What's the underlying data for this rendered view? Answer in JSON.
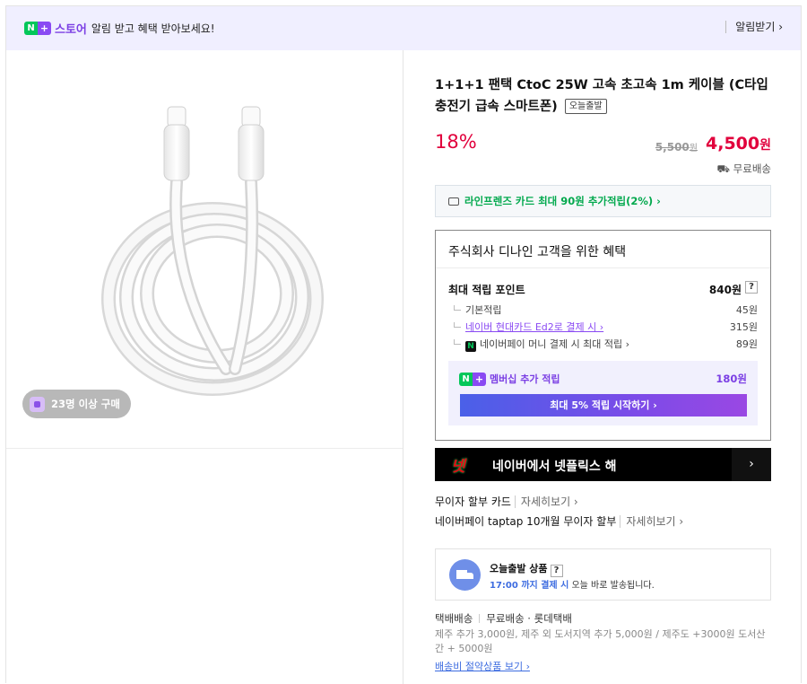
{
  "banner": {
    "badge_n": "N",
    "badge_plus": "+",
    "store": "스토어",
    "text": "알림 받고 혜택 받아보세요!",
    "action": "알림받기 ›"
  },
  "gallery": {
    "buyers_pill": "23명 이상 구매"
  },
  "product": {
    "title": "1+1+1 팬택 CtoC 25W 고속 초고속 1m 케이블 (C타입 충전기 급속 스마트폰)",
    "tag": "오늘출발",
    "discount": "18%",
    "original_price": "5,500",
    "original_unit": "원",
    "price": "4,500",
    "price_unit": "원",
    "shipping": "무료배송"
  },
  "card_benefit": "라인프렌즈 카드 최대 90원 추가적립(2%) ›",
  "benefits": {
    "title": "주식회사 디나인 고객을 위한 혜택",
    "max_label": "최대 적립 포인트",
    "max_value": "840원",
    "help": "?",
    "rows": [
      {
        "label": "기본적립",
        "value": "45원"
      },
      {
        "label": "네이버 현대카드 Ed2로 결제 시 ›",
        "value": "315원"
      },
      {
        "label": "네이버페이 머니 결제 시 최대 적립 ›",
        "value": "89원"
      }
    ],
    "n_mini": "N",
    "membership_label": "멤버십 추가 적립",
    "membership_value": "180원",
    "membership_button": "최대 5% 적립 시작하기 ›"
  },
  "netflix": {
    "logo": "넷",
    "text": "네이버에서 넷플릭스 해",
    "arrow": "›"
  },
  "installments": [
    {
      "label": "무이자 할부 카드",
      "more": "자세히보기 ›"
    },
    {
      "label": "네이버페이 taptap 10개월 무이자 할부",
      "more": "자세히보기 ›"
    }
  ],
  "dispatch": {
    "title": "오늘출발 상품",
    "help": "?",
    "time": "17:00 까지 결제 시",
    "rest": " 오늘 바로 발송됩니다."
  },
  "shipping": {
    "method": "택배배송",
    "fee": "무료배송 · 롯데택배",
    "detail": "제주 추가 3,000원, 제주 외 도서지역 추가 5,000원 / 제주도 +3000원 도서산간 + 5000원",
    "link": "배송비 절약상품 보기 ›"
  },
  "colors": {
    "accent_red": "#e1003c",
    "naver_green": "#03c75a",
    "naver_purple": "#8a4af3",
    "banner_bg": "#f0efff"
  }
}
